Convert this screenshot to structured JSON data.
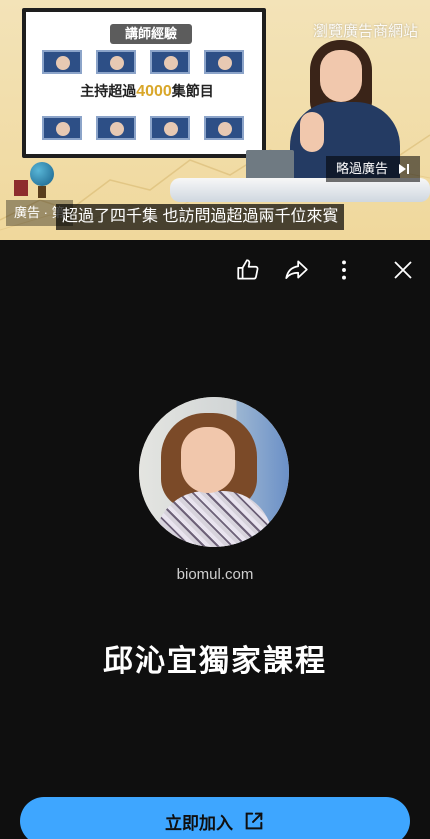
{
  "video": {
    "slide_title": "講師經驗",
    "slide_banner_prefix": "主持超過",
    "slide_banner_accent": "4000",
    "slide_banner_suffix": "集節目",
    "watermark": "瀏覽廣告商網站",
    "skip_ad_label": "略過廣告",
    "ad_chip_label": "廣告 · 第",
    "caption": "超過了四千集  也訪問過超過兩千位來賓"
  },
  "actions": {
    "like_icon": "thumbs-up-icon",
    "share_icon": "share-icon",
    "more_icon": "more-vertical-icon",
    "close_icon": "close-icon"
  },
  "advertiser": {
    "domain": "biomul.com",
    "title": "邱沁宜獨家課程"
  },
  "cta": {
    "label": "立即加入",
    "icon": "open-external-icon"
  },
  "colors": {
    "background": "#0f0f0f",
    "accent": "#3ea6ff",
    "video_bg": "#f0d89c"
  }
}
